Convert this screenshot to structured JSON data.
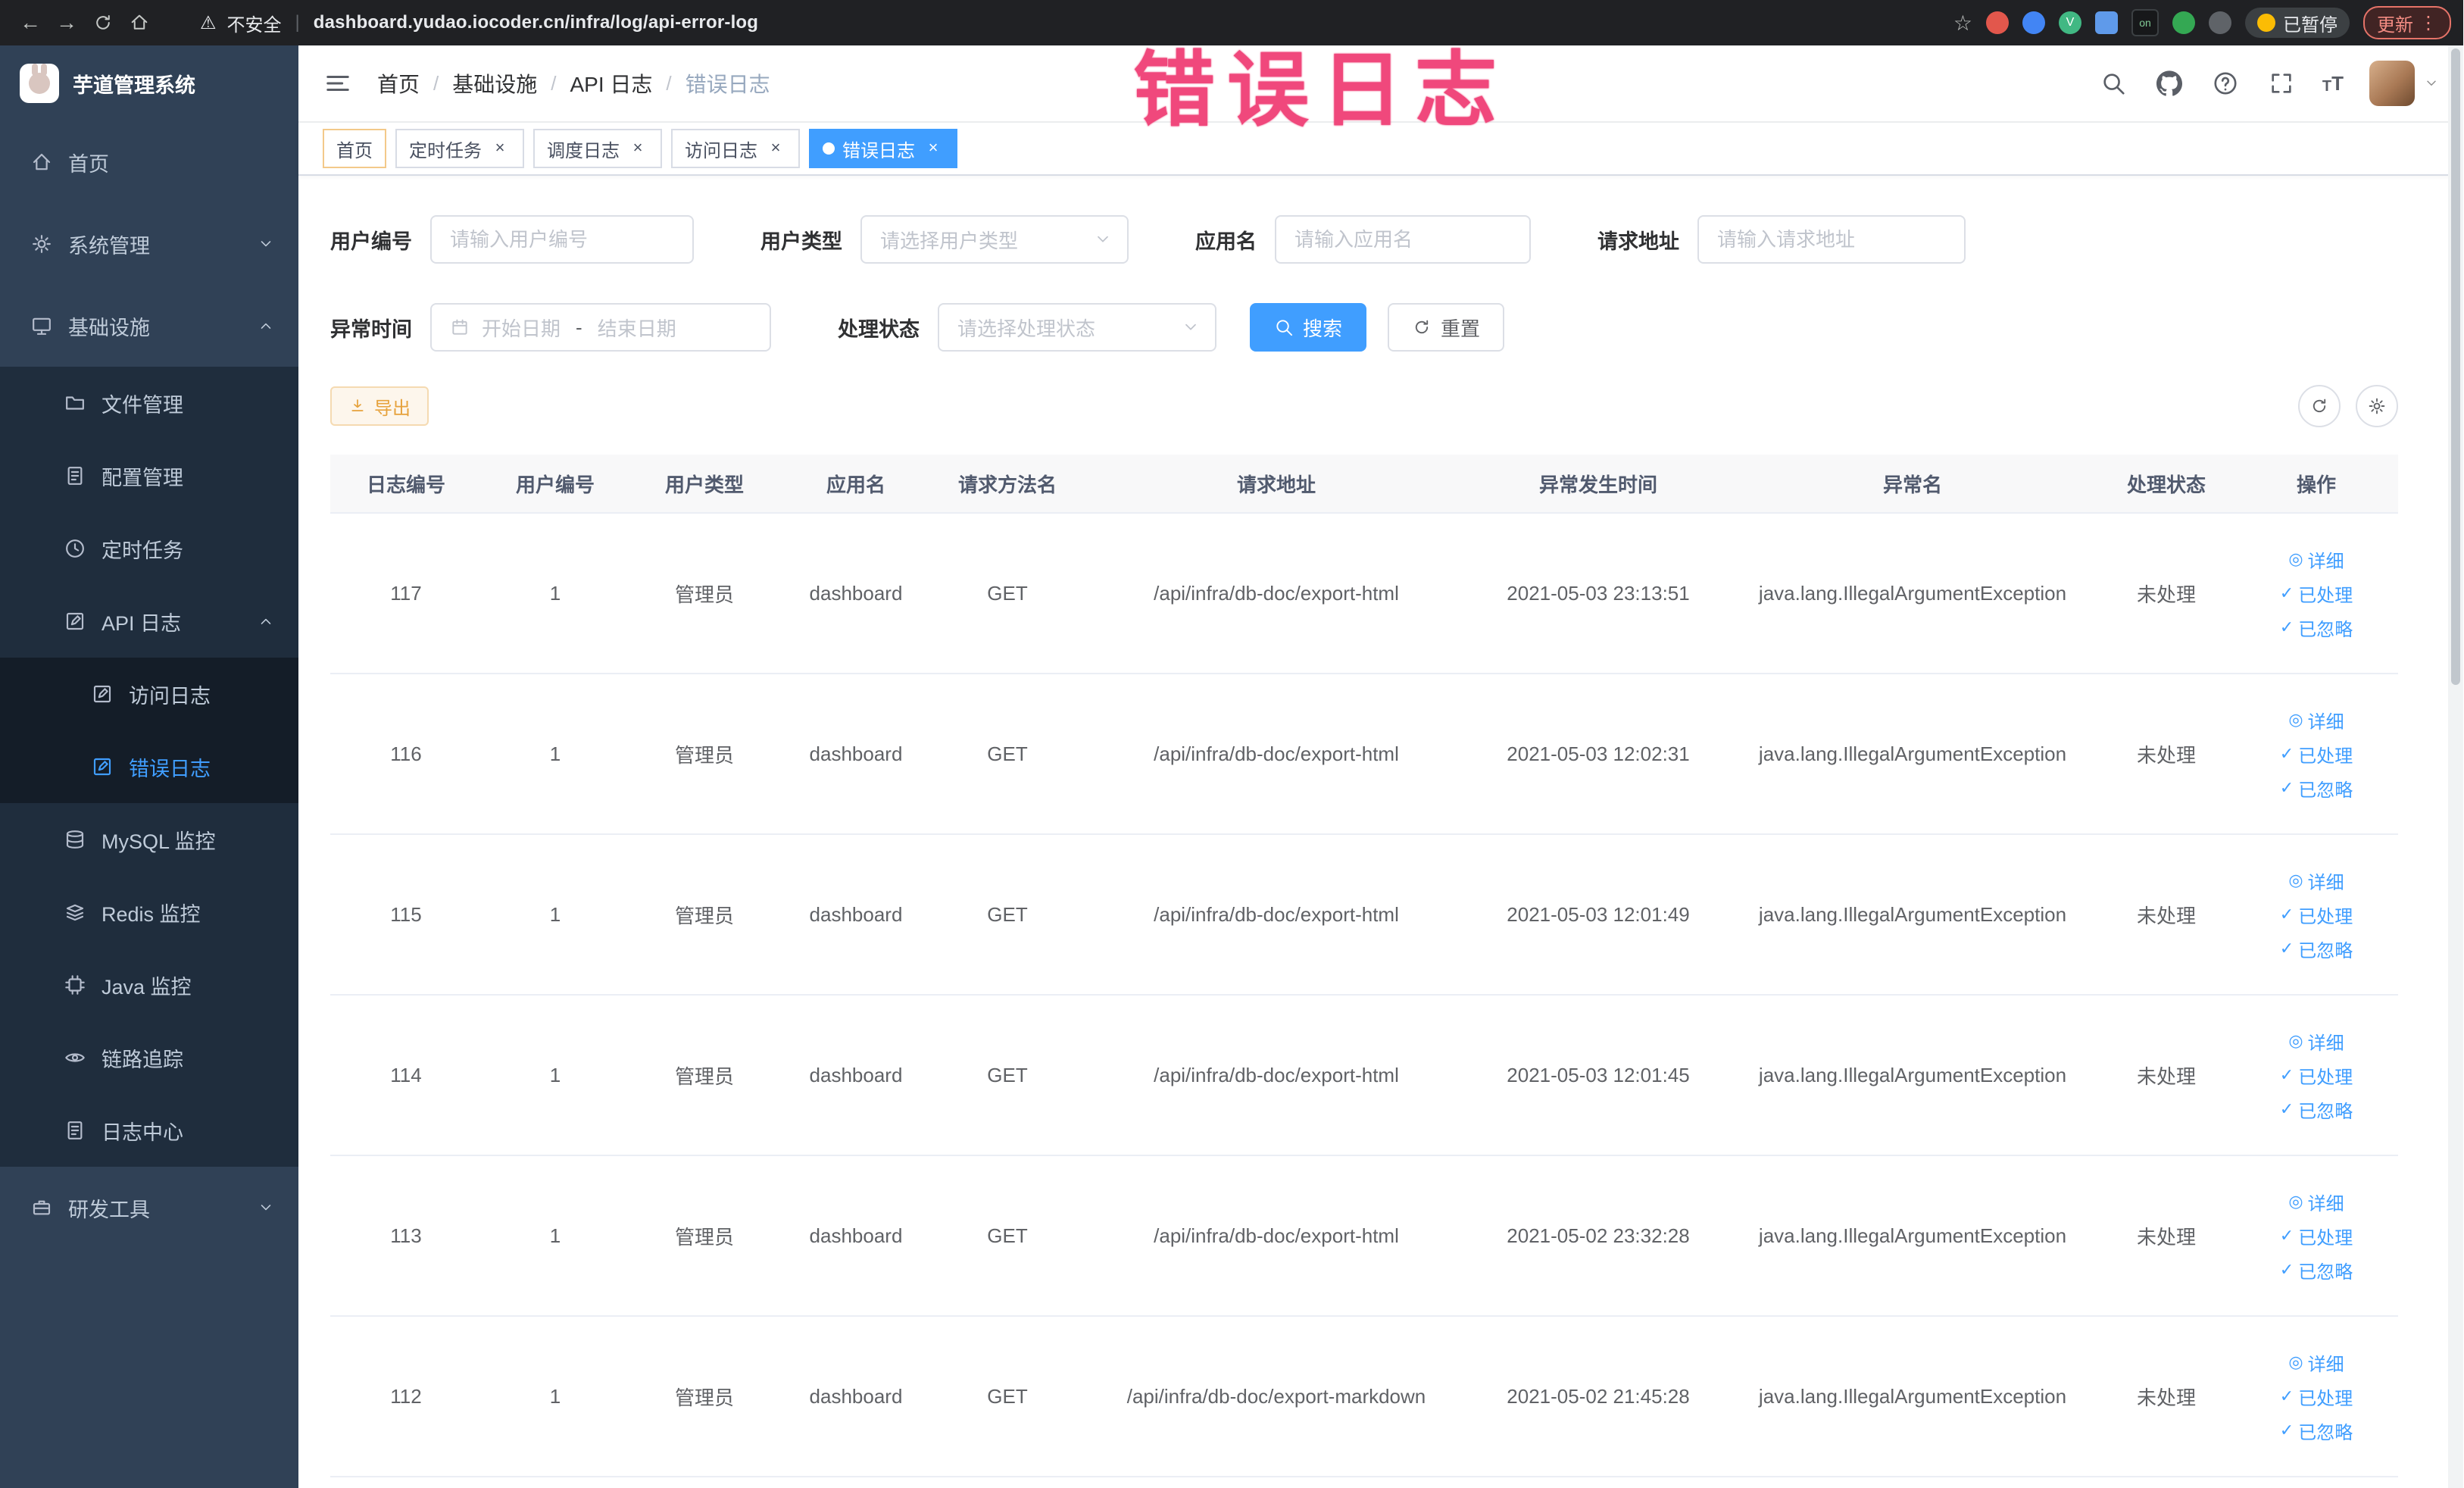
{
  "annotation": {
    "text": "错误日志"
  },
  "browser": {
    "security_label": "不安全",
    "url": "dashboard.yudao.iocoder.cn/infra/log/api-error-log",
    "ext_on_label": "on",
    "paused_label": "已暂停",
    "update_label": "更新"
  },
  "sidebar": {
    "logo_title": "芋道管理系统",
    "items": [
      {
        "key": "home",
        "label": "首页",
        "icon": "home-icon",
        "depth": 0
      },
      {
        "key": "system",
        "label": "系统管理",
        "icon": "gear-icon",
        "depth": 0,
        "arrow": "down"
      },
      {
        "key": "infra",
        "label": "基础设施",
        "icon": "monitor-icon",
        "depth": 0,
        "arrow": "up"
      },
      {
        "key": "files",
        "label": "文件管理",
        "icon": "folder-icon",
        "depth": 1
      },
      {
        "key": "config",
        "label": "配置管理",
        "icon": "doc-icon",
        "depth": 1
      },
      {
        "key": "jobs",
        "label": "定时任务",
        "icon": "clock-icon",
        "depth": 1
      },
      {
        "key": "api-log",
        "label": "API 日志",
        "icon": "edit-doc-icon",
        "depth": 1,
        "arrow": "up"
      },
      {
        "key": "access-log",
        "label": "访问日志",
        "icon": "edit-doc-icon",
        "depth": 2
      },
      {
        "key": "error-log",
        "label": "错误日志",
        "icon": "edit-doc-icon",
        "depth": 2,
        "active": true
      },
      {
        "key": "mysql",
        "label": "MySQL 监控",
        "icon": "database-icon",
        "depth": 1
      },
      {
        "key": "redis",
        "label": "Redis 监控",
        "icon": "layers-icon",
        "depth": 1
      },
      {
        "key": "java",
        "label": "Java 监控",
        "icon": "cpu-icon",
        "depth": 1
      },
      {
        "key": "trace",
        "label": "链路追踪",
        "icon": "eye-icon",
        "depth": 1
      },
      {
        "key": "log-center",
        "label": "日志中心",
        "icon": "doc-icon",
        "depth": 1
      },
      {
        "key": "dev-tools",
        "label": "研发工具",
        "icon": "briefcase-icon",
        "depth": 0,
        "arrow": "down"
      }
    ]
  },
  "header": {
    "breadcrumbs": [
      "首页",
      "基础设施",
      "API 日志",
      "错误日志"
    ]
  },
  "tabs": [
    {
      "key": "home",
      "label": "首页",
      "closable": false,
      "active": false
    },
    {
      "key": "jobs",
      "label": "定时任务",
      "closable": true,
      "active": false
    },
    {
      "key": "job-log",
      "label": "调度日志",
      "closable": true,
      "active": false
    },
    {
      "key": "access-log",
      "label": "访问日志",
      "closable": true,
      "active": false
    },
    {
      "key": "error-log",
      "label": "错误日志",
      "closable": true,
      "active": true
    }
  ],
  "filters": {
    "user_id": {
      "label": "用户编号",
      "placeholder": "请输入用户编号"
    },
    "user_type": {
      "label": "用户类型",
      "placeholder": "请选择用户类型"
    },
    "app_name": {
      "label": "应用名",
      "placeholder": "请输入应用名"
    },
    "request_url": {
      "label": "请求地址",
      "placeholder": "请输入请求地址"
    },
    "exception_time": {
      "label": "异常时间",
      "start_placeholder": "开始日期",
      "separator": "-",
      "end_placeholder": "结束日期"
    },
    "process_status": {
      "label": "处理状态",
      "placeholder": "请选择处理状态"
    },
    "search_button": "搜索",
    "reset_button": "重置"
  },
  "toolbar": {
    "export_button": "导出"
  },
  "table": {
    "columns": [
      "日志编号",
      "用户编号",
      "用户类型",
      "应用名",
      "请求方法名",
      "请求地址",
      "异常发生时间",
      "异常名",
      "处理状态",
      "操作"
    ],
    "actions": [
      "详细",
      "已处理",
      "已忽略"
    ],
    "rows": [
      {
        "id": "117",
        "user_id": "1",
        "user_type": "管理员",
        "app": "dashboard",
        "method": "GET",
        "url": "/api/infra/db-doc/export-html",
        "time": "2021-05-03 23:13:51",
        "exception": "java.lang.IllegalArgumentException",
        "status": "未处理"
      },
      {
        "id": "116",
        "user_id": "1",
        "user_type": "管理员",
        "app": "dashboard",
        "method": "GET",
        "url": "/api/infra/db-doc/export-html",
        "time": "2021-05-03 12:02:31",
        "exception": "java.lang.IllegalArgumentException",
        "status": "未处理"
      },
      {
        "id": "115",
        "user_id": "1",
        "user_type": "管理员",
        "app": "dashboard",
        "method": "GET",
        "url": "/api/infra/db-doc/export-html",
        "time": "2021-05-03 12:01:49",
        "exception": "java.lang.IllegalArgumentException",
        "status": "未处理"
      },
      {
        "id": "114",
        "user_id": "1",
        "user_type": "管理员",
        "app": "dashboard",
        "method": "GET",
        "url": "/api/infra/db-doc/export-html",
        "time": "2021-05-03 12:01:45",
        "exception": "java.lang.IllegalArgumentException",
        "status": "未处理"
      },
      {
        "id": "113",
        "user_id": "1",
        "user_type": "管理员",
        "app": "dashboard",
        "method": "GET",
        "url": "/api/infra/db-doc/export-html",
        "time": "2021-05-02 23:32:28",
        "exception": "java.lang.IllegalArgumentException",
        "status": "未处理"
      },
      {
        "id": "112",
        "user_id": "1",
        "user_type": "管理员",
        "app": "dashboard",
        "method": "GET",
        "url": "/api/infra/db-doc/export-markdown",
        "time": "2021-05-02 21:45:28",
        "exception": "java.lang.IllegalArgumentException",
        "status": "未处理"
      }
    ]
  }
}
